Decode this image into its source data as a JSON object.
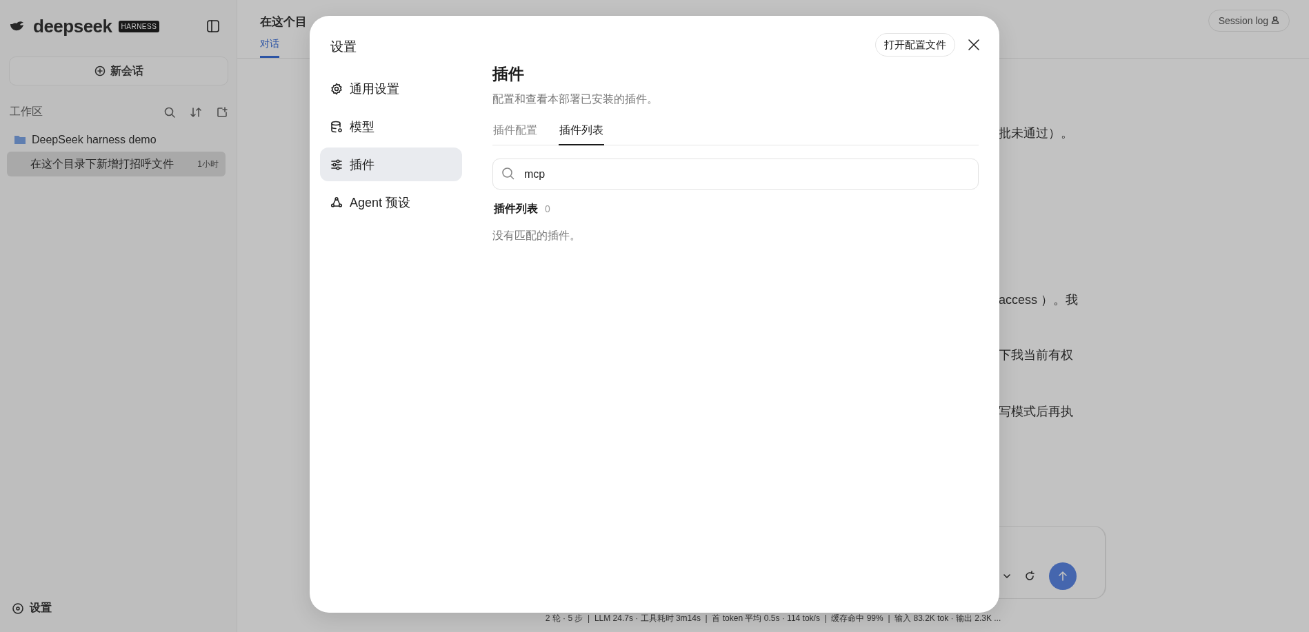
{
  "sidebar": {
    "logo": "deepseek",
    "badge": "HARNESS",
    "new_chat": "新会话",
    "section": "工作区",
    "workspace": {
      "name": "DeepSeek harness demo",
      "sessions": [
        {
          "title": "在这个目录下新增打招呼文件",
          "time": "1小时",
          "selected": true
        }
      ]
    },
    "settings": "设置"
  },
  "main": {
    "title": "在这个目",
    "tabs": [
      {
        "label": "对话",
        "selected": true
      }
    ],
    "session_log": "Session log",
    "message_fragments": [
      "批未通过）。",
      "access ）。我",
      "下我当前有权",
      "写模式后再执"
    ],
    "status_bar": "2 轮 · 5 步  |  LLM 24.7s · 工具耗时 3m14s  |  首 token 平均 0.5s · 114 tok/s  |  缓存命中 99%  |  输入 83.2K tok · 输出 2.3K ..."
  },
  "dialog": {
    "title": "设置",
    "open_config": "打开配置文件",
    "nav": [
      {
        "label": "通用设置",
        "selected": false
      },
      {
        "label": "模型",
        "selected": false
      },
      {
        "label": "插件",
        "selected": true
      },
      {
        "label": "Agent 预设",
        "selected": false
      }
    ],
    "heading": "插件",
    "description": "配置和查看本部署已安装的插件。",
    "tabs": [
      {
        "label": "插件配置",
        "selected": false
      },
      {
        "label": "插件列表",
        "selected": true
      }
    ],
    "search": {
      "value": "mcp"
    },
    "list": {
      "title": "插件列表",
      "count": "0",
      "empty": "没有匹配的插件。"
    }
  }
}
